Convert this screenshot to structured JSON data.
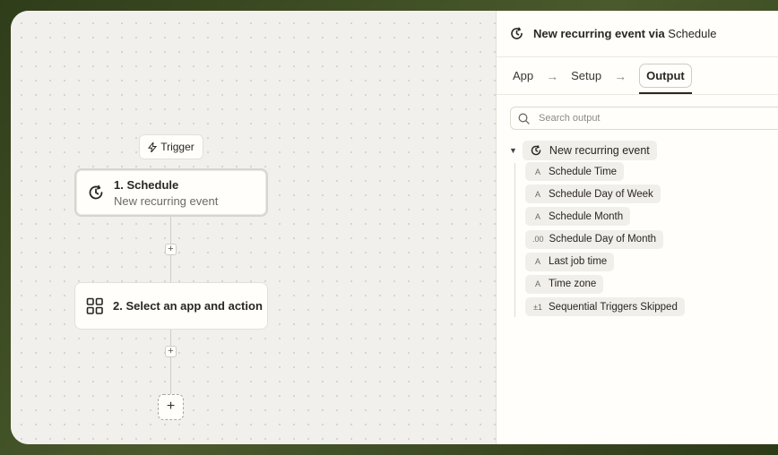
{
  "canvas": {
    "trigger_label": "Trigger",
    "steps": [
      {
        "number_title": "1. Schedule",
        "subtitle": "New recurring event"
      },
      {
        "number_title": "2. Select an app and action"
      }
    ],
    "add_symbol": "+"
  },
  "panel": {
    "title_prefix": "New recurring event via",
    "title_app": "Schedule",
    "tabs": [
      {
        "label": "App"
      },
      {
        "label": "Setup"
      },
      {
        "label": "Output"
      }
    ],
    "tab_arrow": "→",
    "search_placeholder": "Search output",
    "root_item": {
      "label": "New recurring event",
      "caret": "▼"
    },
    "fields": [
      {
        "type_symbol": "A",
        "label": "Schedule Time"
      },
      {
        "type_symbol": "A",
        "label": "Schedule Day of Week"
      },
      {
        "type_symbol": "A",
        "label": "Schedule Month"
      },
      {
        "type_symbol": ".00",
        "label": "Schedule Day of Month"
      },
      {
        "type_symbol": "A",
        "label": "Last job time"
      },
      {
        "type_symbol": "A",
        "label": "Time zone"
      },
      {
        "type_symbol": "±1",
        "label": "Sequential Triggers Skipped"
      }
    ]
  }
}
